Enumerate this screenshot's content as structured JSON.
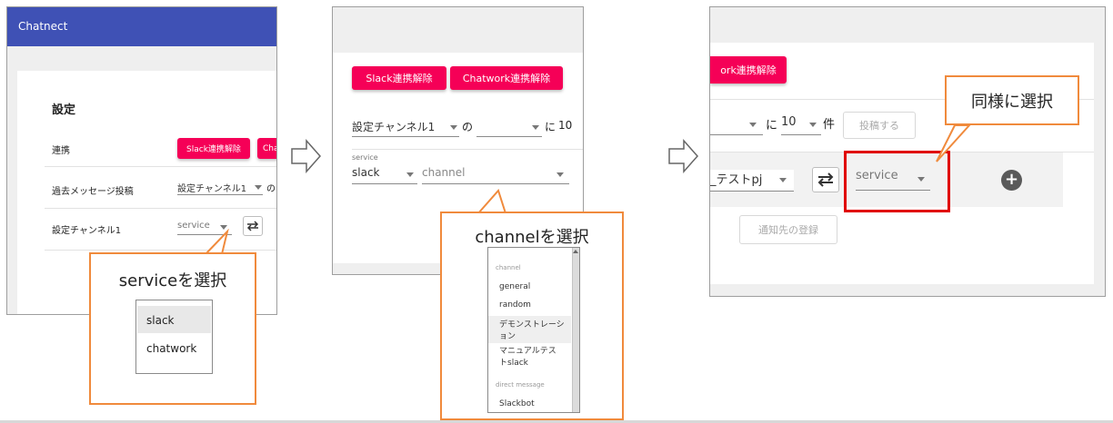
{
  "panel1": {
    "app_title": "Chatnect",
    "settings_title": "設定",
    "rows": [
      {
        "label": "連携"
      },
      {
        "label": "過去メッセージ投稿"
      },
      {
        "label": "設定チャンネル1"
      }
    ],
    "slack_unlink": "Slack連携解除",
    "chatwork_unlink_partial": "Cha",
    "channel_select_value": "設定チャンネル1",
    "no_text": "の",
    "service_select": "service",
    "callout_title": "serviceを選択",
    "service_options": [
      "slack",
      "chatwork"
    ]
  },
  "panel2": {
    "slack_unlink": "Slack連携解除",
    "chatwork_unlink": "Chatwork連携解除",
    "channel_select_value": "設定チャンネル1",
    "no_text": "の",
    "ni_text": "に",
    "count_value": "10",
    "service_label": "service",
    "service_value": "slack",
    "channel_placeholder": "channel",
    "callout_title": "channelを選択",
    "channel_group_label": "channel",
    "channels": [
      "general",
      "random",
      "デモンストレーション",
      "マニュアルテストslack"
    ],
    "dm_group_label": "direct message",
    "dm_items": [
      "Slackbot"
    ]
  },
  "panel3": {
    "chatwork_unlink_partial": "ork連携解除",
    "ni_text": "に",
    "count_value": "10",
    "ken_text": "件",
    "post_button": "投稿する",
    "project_select_partial": "_テストpj",
    "service_select": "service",
    "register_button": "通知先の登録",
    "callout_title": "同様に選択"
  },
  "colors": {
    "app_bar": "#3f51b5",
    "accent_pink": "#f50057",
    "callout_border": "#f08a3c",
    "highlight_red": "#e00000"
  }
}
